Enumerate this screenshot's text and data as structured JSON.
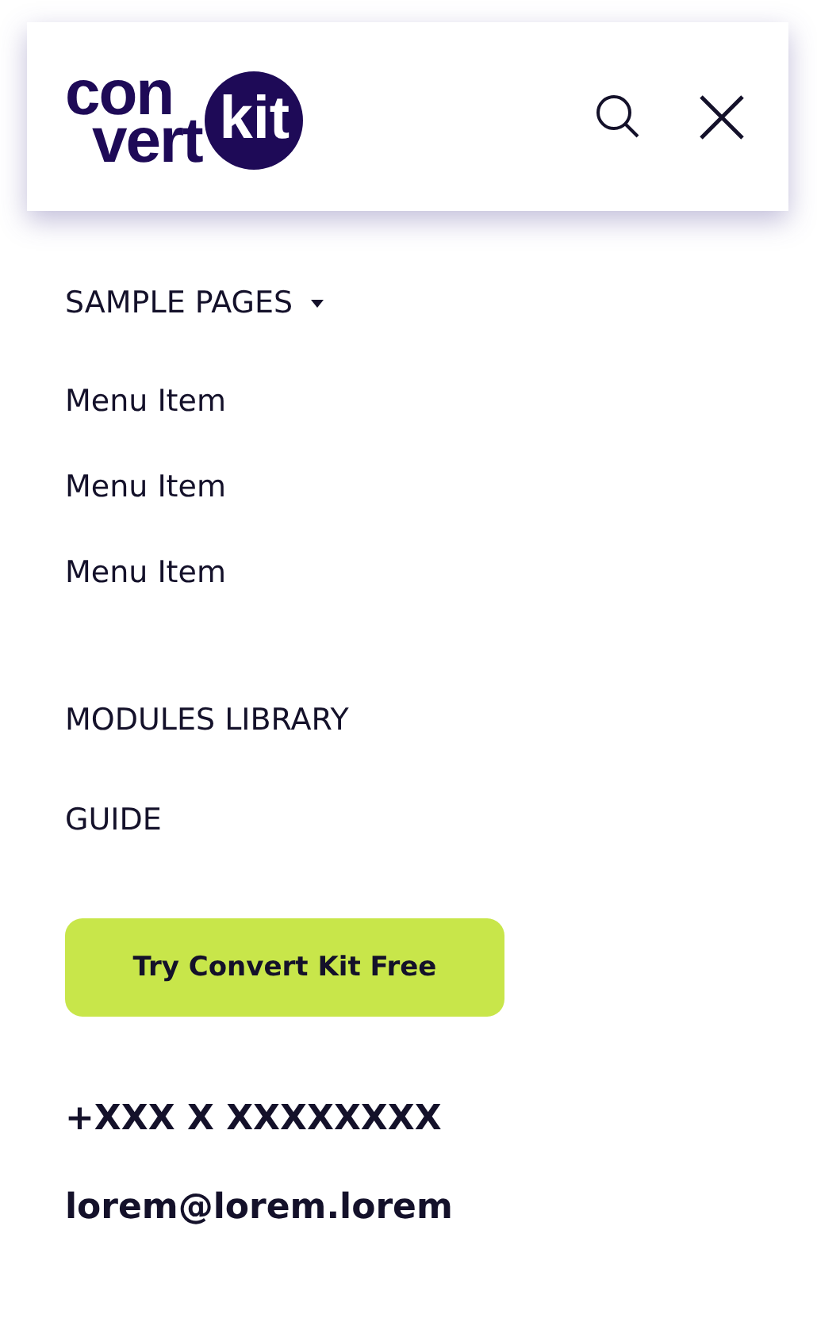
{
  "header": {
    "logo": {
      "line_1": "con",
      "line_2": "vert",
      "badge": "kit"
    }
  },
  "menu": {
    "label": "SAMPLE PAGES",
    "expanded": true,
    "items": [
      {
        "label": "Menu Item"
      },
      {
        "label": "Menu Item"
      },
      {
        "label": "Menu Item"
      }
    ]
  },
  "links": [
    {
      "label": "MODULES LIBRARY"
    },
    {
      "label": "GUIDE"
    }
  ],
  "cta": {
    "label": "Try Convert Kit Free"
  },
  "contact": {
    "phone": "+XXX X XXXXXXXX",
    "email": "lorem@lorem.lorem"
  }
}
